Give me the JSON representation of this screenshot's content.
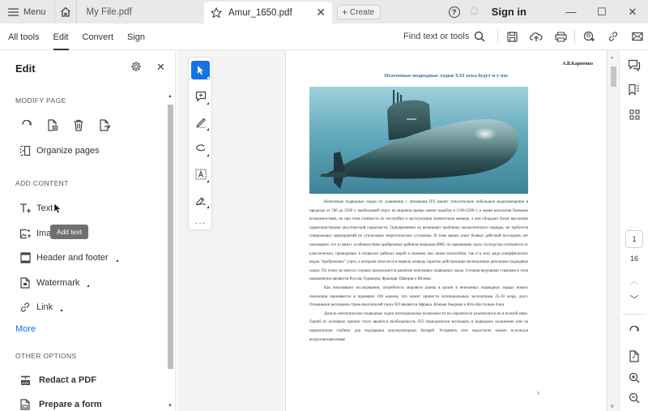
{
  "titlebar": {
    "menu_label": "Menu",
    "tabs": [
      {
        "label": "My File.pdf",
        "active": false
      },
      {
        "label": "Amur_1650.pdf",
        "active": true
      }
    ],
    "create_label": "Create",
    "sign_in": "Sign in"
  },
  "toolbar": {
    "nav": [
      "All tools",
      "Edit",
      "Convert",
      "Sign"
    ],
    "active_nav": "Edit",
    "find_placeholder": "Find text or tools",
    "icons": [
      "save-icon",
      "upload-cloud-icon",
      "print-icon",
      "add-user-icon",
      "link-icon",
      "email-icon"
    ]
  },
  "left_panel": {
    "title": "Edit",
    "modify_page_heading": "MODIFY PAGE",
    "modify_icons": [
      "rotate-icon",
      "insert-page-icon",
      "delete-icon",
      "extract-page-icon"
    ],
    "organize_pages": "Organize pages",
    "add_content_heading": "ADD CONTENT",
    "add_content_items": [
      {
        "label": "Text",
        "icon": "add-text-icon"
      },
      {
        "label": "Image",
        "icon": "add-image-icon"
      },
      {
        "label": "Header and footer",
        "icon": "header-footer-icon"
      },
      {
        "label": "Watermark",
        "icon": "watermark-icon"
      },
      {
        "label": "Link",
        "icon": "link-icon"
      }
    ],
    "more_label": "More",
    "other_options_heading": "OTHER OPTIONS",
    "other_items": [
      {
        "label": "Redact a PDF",
        "icon": "redact-icon"
      },
      {
        "label": "Prepare a form",
        "icon": "form-icon"
      }
    ],
    "tooltip": "Add text"
  },
  "quick_tools": [
    "select-cursor-icon",
    "add-comment-icon",
    "highlight-pen-icon",
    "draw-freehand-icon",
    "text-box-icon",
    "signature-icon",
    "more-icon"
  ],
  "document": {
    "author": "А.В.Карпенко",
    "title": "Неатомные подводные лодки XXI века будут и  у нас",
    "paragraphs": [
      "Неатомные подводные лодки по сравнению с атомными ПЛ имеют относительно небольшое водоизмещение в пределах от 500 до 2500 т, наибольший спрос на мировом рынке имеют корабли в 1500-2500 т, и менее высокими боевыми возможностями, но при этом стоимость их постройки и эксплуатации значительно меньше, а они обладают более высокими характеристиками акустической скрытности. Одновременно не возникают проблемы экологического порядка, не требуется специальных мероприятий по утилизации энергетических установок. В тоже время, опыт боевых действий последних лет показывает, что в связи с особенностями прибрежных районов операции ВМС по завоеванию здесь господства отличаются от классических, проводимых в открытых районах морей и океанов, как своим масштабом, так и в силу ряда специфических видов \"прибрежных\" угроз, к которым относятся в первую очередь скрытно действующие малошумные дизельные подводные лодки. По этому во многих странах продолжается развитие неатомных подводных лодок. Сегодня ведущими странами в этом направлении являются Россия, Германия, Франция, Швеция и Япония.",
      "Как показывают исследования, потребность мирового рынка в целом в неатомных подводных лодках нового поколения оценивается в примерно 100 единиц, что может принести потенциальным экспортерам 25-30 млрд. долл. Основными регионами стран-покупателей таких ПЛ являются Африка, Южная Америка и Юго-Восточная Азия.",
      "Дизель-электрические подводные лодки потенциальные возможности по скрытности реализуются не в полной мере. Одной из основных причин этого является необходимость ПЛ периодически всплывать в надводное положение или на перископную глубину для подзарядки аккумуляторных батарей. Устранить этот недостаток можно используя воздухонезависимые"
    ],
    "page_number": "1",
    "image_alt": "submarine-photo"
  },
  "right_panel": {
    "icons": [
      "comments-icon",
      "bookmarks-icon",
      "thumbnails-icon"
    ],
    "current_page": "1",
    "total_pages": "16",
    "bottom_icons": [
      "rotate-view-icon",
      "page-fit-icon",
      "zoom-in-icon",
      "zoom-out-icon"
    ]
  }
}
